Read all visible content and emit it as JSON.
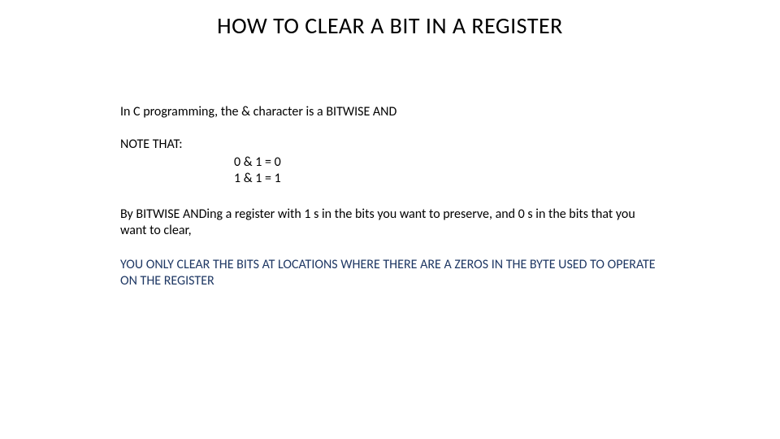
{
  "title": "HOW TO CLEAR A BIT IN A REGISTER",
  "intro": "In C programming, the & character is a BITWISE AND",
  "note_label": "NOTE THAT:",
  "truth": {
    "line1": "0 & 1 = 0",
    "line2": "1 & 1  = 1"
  },
  "explain": "By BITWISE ANDing a register with 1 s in the bits you want to preserve, and 0 s in the bits that you want to clear,",
  "emph": "YOU ONLY CLEAR THE BITS AT LOCATIONS WHERE THERE ARE A ZEROS IN THE BYTE USED TO OPERATE ON THE REGISTER"
}
